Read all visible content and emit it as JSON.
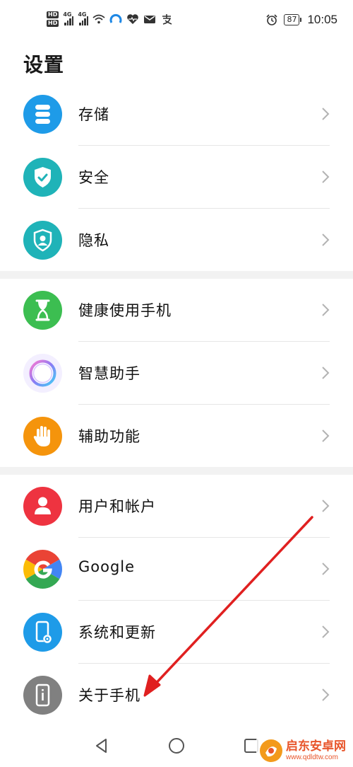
{
  "status_bar": {
    "hd_labels": [
      "HD",
      "HD"
    ],
    "signal_labels": [
      "4G",
      "4G"
    ],
    "battery": "87",
    "time": "10:05"
  },
  "page": {
    "title": "设置"
  },
  "sections": [
    {
      "items": [
        {
          "label": "存储",
          "icon": "storage-icon",
          "color": "#1e9be8"
        },
        {
          "label": "安全",
          "icon": "shield-check-icon",
          "color": "#1fb3b8"
        },
        {
          "label": "隐私",
          "icon": "privacy-shield-icon",
          "color": "#1fb3b8"
        }
      ]
    },
    {
      "items": [
        {
          "label": "健康使用手机",
          "icon": "hourglass-icon",
          "color": "#3cbe51"
        },
        {
          "label": "智慧助手",
          "icon": "assistant-ring-icon",
          "color": "#8a7cf5"
        },
        {
          "label": "辅助功能",
          "icon": "hand-icon",
          "color": "#f5940c"
        }
      ]
    },
    {
      "items": [
        {
          "label": "用户和帐户",
          "icon": "user-icon",
          "color": "#ee3340"
        },
        {
          "label": "Google",
          "icon": "google-icon",
          "color": "#4285f4"
        },
        {
          "label": "系统和更新",
          "icon": "phone-settings-icon",
          "color": "#1e9be8"
        },
        {
          "label": "关于手机",
          "icon": "phone-info-icon",
          "color": "#808080"
        }
      ]
    }
  ],
  "annotation": {
    "color": "#e02020"
  },
  "watermark": {
    "name": "启东安卓网",
    "url": "www.qdldtw.com"
  }
}
